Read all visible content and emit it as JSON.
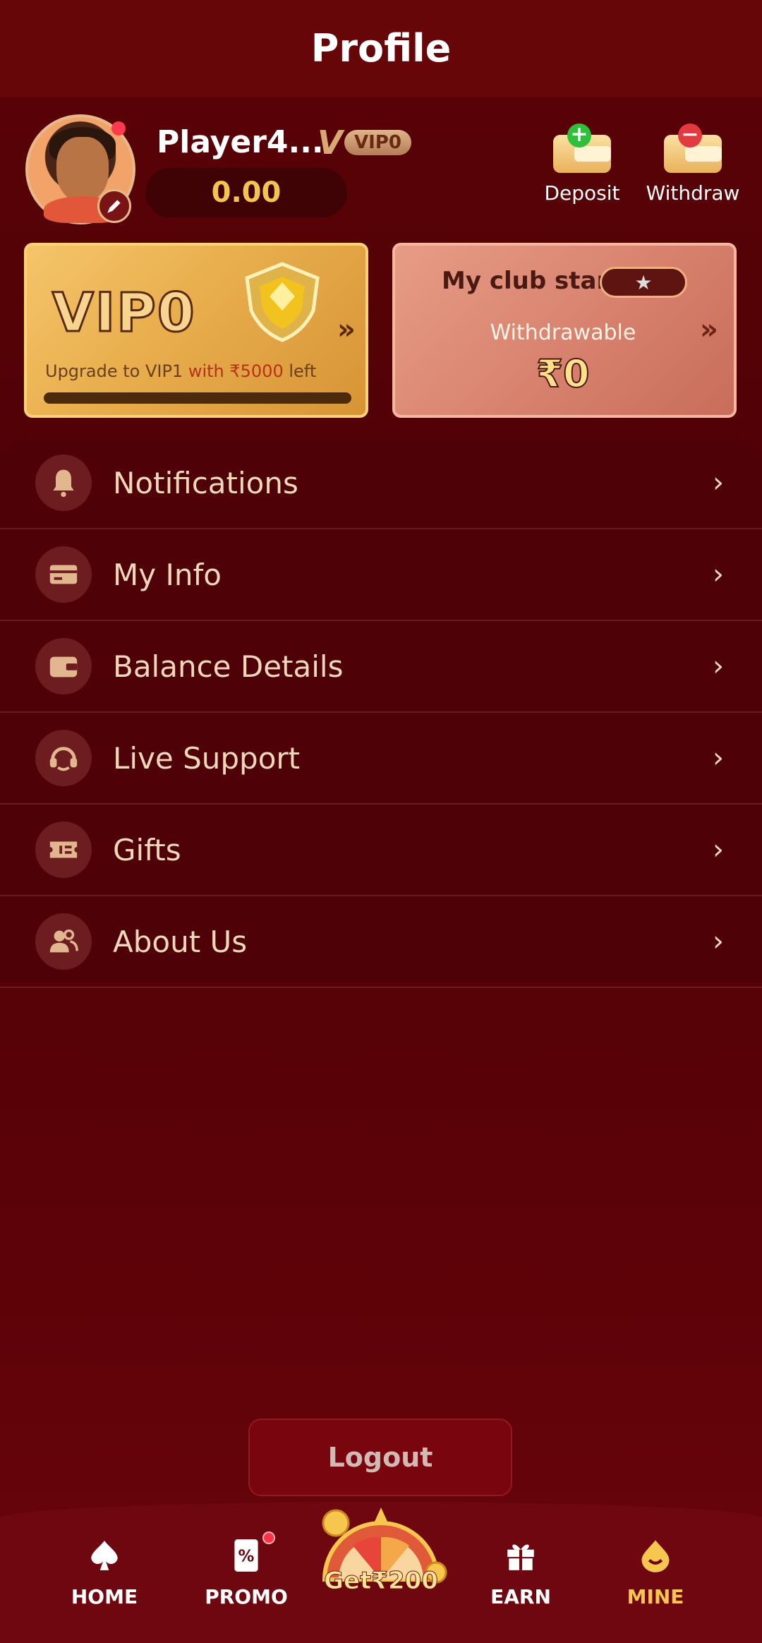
{
  "header": {
    "title": "Profile"
  },
  "profile": {
    "player_name": "Player4...",
    "vip_badge": "VIP0",
    "balance": "0.00"
  },
  "actions": {
    "deposit_label": "Deposit",
    "withdraw_label": "Withdraw"
  },
  "vip_card": {
    "level": "VIP0",
    "upgrade_prefix": "Upgrade to VIP1 ",
    "upgrade_highlight": "with ₹5000",
    "upgrade_suffix": " left",
    "progress_fraction": 0
  },
  "club_card": {
    "star_label": "My club star:",
    "withdrawable_label": "Withdrawable",
    "withdrawable_amount": "₹0"
  },
  "menu": {
    "items": [
      {
        "label": "Notifications",
        "icon": "bell-icon"
      },
      {
        "label": "My Info",
        "icon": "id-card-icon"
      },
      {
        "label": "Balance Details",
        "icon": "wallet-icon"
      },
      {
        "label": "Live Support",
        "icon": "headset-icon"
      },
      {
        "label": "Gifts",
        "icon": "ticket-icon"
      },
      {
        "label": "About Us",
        "icon": "people-icon"
      }
    ]
  },
  "logout_label": "Logout",
  "bottom_nav": {
    "home": "HOME",
    "promo": "PROMO",
    "get": "Get₹200",
    "earn": "EARN",
    "mine": "MINE",
    "active": "MINE"
  },
  "colors": {
    "accent_gold": "#f6c64e",
    "background": "#4e0106",
    "header": "#660609"
  }
}
